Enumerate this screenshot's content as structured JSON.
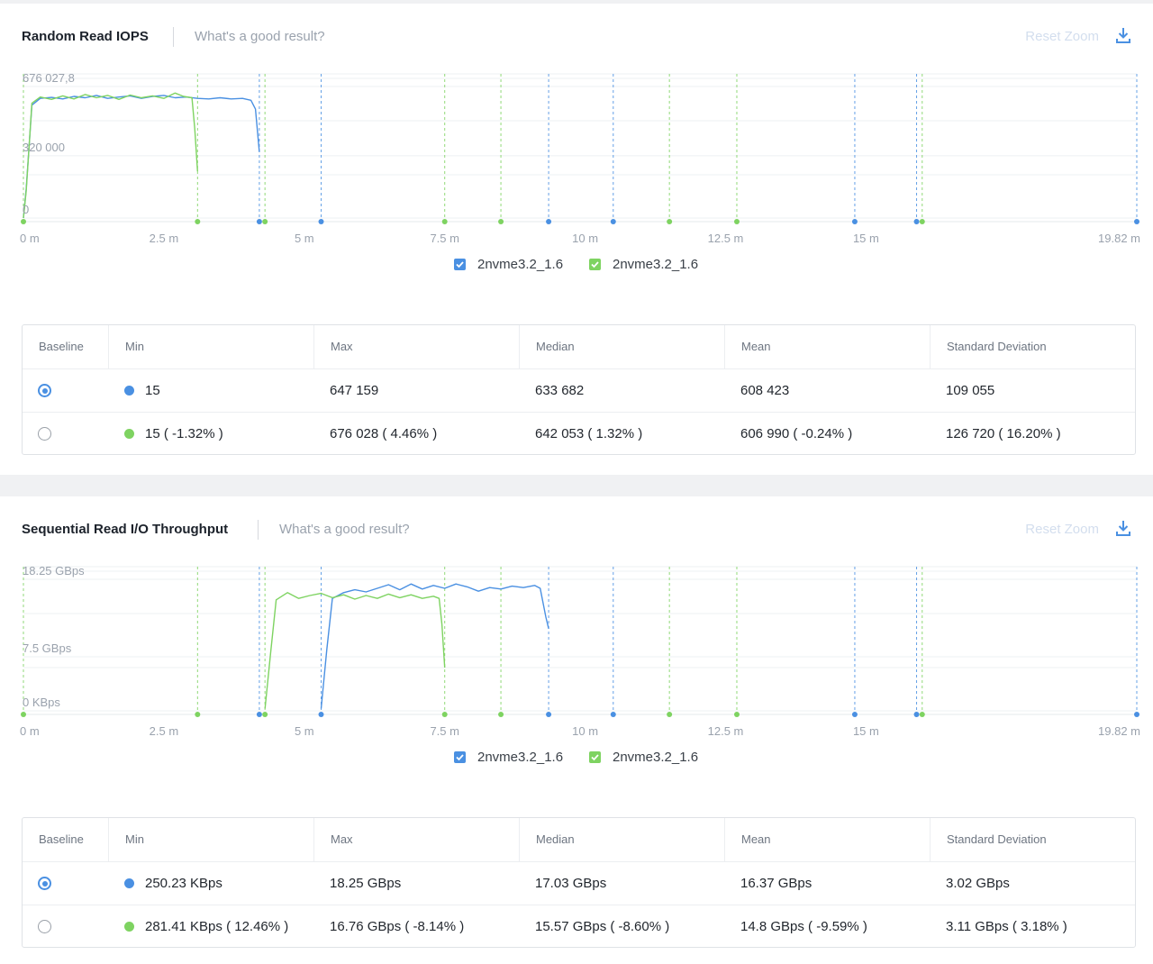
{
  "panels": [
    {
      "title": "Random Read IOPS",
      "link": "What's a good result?",
      "reset_zoom": "Reset Zoom",
      "legend": [
        "2nvme3.2_1.6",
        "2nvme3.2_1.6"
      ],
      "columns": [
        "Baseline",
        "Min",
        "Max",
        "Median",
        "Mean",
        "Standard Deviation"
      ],
      "rows": [
        {
          "baseline": true,
          "color": "#4a90e2",
          "min": "15",
          "max": "647 159",
          "median": "633 682",
          "mean": "608 423",
          "std": "109 055"
        },
        {
          "baseline": false,
          "color": "#7ed361",
          "min": "15 ( -1.32% )",
          "max": "676 028 ( 4.46% )",
          "median": "642 053 ( 1.32% )",
          "mean": "606 990 ( -0.24% )",
          "std": "126 720 ( 16.20% )"
        }
      ]
    },
    {
      "title": "Sequential Read I/O Throughput",
      "link": "What's a good result?",
      "reset_zoom": "Reset Zoom",
      "legend": [
        "2nvme3.2_1.6",
        "2nvme3.2_1.6"
      ],
      "columns": [
        "Baseline",
        "Min",
        "Max",
        "Median",
        "Mean",
        "Standard Deviation"
      ],
      "rows": [
        {
          "baseline": true,
          "color": "#4a90e2",
          "min": "250.23 KBps",
          "max": "18.25 GBps",
          "median": "17.03 GBps",
          "mean": "16.37 GBps",
          "std": "3.02 GBps"
        },
        {
          "baseline": false,
          "color": "#7ed361",
          "min": "281.41 KBps ( 12.46% )",
          "max": "16.76 GBps ( -8.14% )",
          "median": "15.57 GBps ( -8.60% )",
          "mean": "14.8 GBps ( -9.59% )",
          "std": "3.11 GBps ( 3.18% )"
        }
      ]
    }
  ],
  "colors": {
    "blue": "#4a90e2",
    "green": "#7ed361"
  },
  "chart_data": [
    {
      "type": "line",
      "title": "Random Read IOPS",
      "x_unit": "minutes",
      "xlim": [
        0,
        19.82
      ],
      "ylim": [
        0,
        676027.8
      ],
      "x_tick_labels": [
        "0 m",
        "2.5 m",
        "5 m",
        "7.5 m",
        "10 m",
        "12.5 m",
        "15 m",
        "19.82 m"
      ],
      "x_ticks": [
        0,
        2.5,
        5,
        7.5,
        10,
        12.5,
        15,
        19.82
      ],
      "y_tick_labels": [
        "676 027,8",
        "320 000",
        "0"
      ],
      "y_ticks": [
        676027.8,
        320000,
        0
      ],
      "grid": true,
      "legend_position": "bottom-center",
      "event_markers": {
        "blue": [
          4.2,
          5.3,
          9.35,
          10.5,
          14.8,
          15.9,
          19.82
        ],
        "green": [
          0,
          3.1,
          4.3,
          7.5,
          8.5,
          11.5,
          12.7,
          16.0
        ]
      },
      "series": [
        {
          "name": "2nvme3.2_1.6",
          "color": "#4a90e2",
          "x": [
            0,
            0.05,
            0.15,
            0.3,
            0.5,
            0.7,
            0.9,
            1.1,
            1.3,
            1.5,
            1.7,
            1.9,
            2.1,
            2.3,
            2.5,
            2.7,
            2.9,
            3.1,
            3.3,
            3.5,
            3.7,
            3.9,
            4.05,
            4.13,
            4.2
          ],
          "y": [
            0,
            150000,
            580000,
            615000,
            620000,
            612000,
            625000,
            618000,
            630000,
            615000,
            622000,
            628000,
            615000,
            625000,
            630000,
            618000,
            622000,
            615000,
            612000,
            618000,
            612000,
            615000,
            605000,
            560000,
            340000
          ]
        },
        {
          "name": "2nvme3.2_1.6",
          "color": "#7ed361",
          "x": [
            0,
            0.05,
            0.15,
            0.3,
            0.5,
            0.7,
            0.9,
            1.1,
            1.3,
            1.5,
            1.7,
            1.9,
            2.1,
            2.3,
            2.5,
            2.7,
            2.85,
            3.0,
            3.05,
            3.1
          ],
          "y": [
            0,
            140000,
            590000,
            622000,
            610000,
            628000,
            612000,
            635000,
            618000,
            630000,
            610000,
            632000,
            618000,
            628000,
            615000,
            642000,
            625000,
            618000,
            460000,
            240000
          ]
        }
      ]
    },
    {
      "type": "line",
      "title": "Sequential Read I/O Throughput",
      "x_unit": "minutes",
      "xlim": [
        0,
        19.82
      ],
      "ylim": [
        0,
        18.25
      ],
      "x_tick_labels": [
        "0 m",
        "2.5 m",
        "5 m",
        "7.5 m",
        "10 m",
        "12.5 m",
        "15 m",
        "19.82 m"
      ],
      "x_ticks": [
        0,
        2.5,
        5,
        7.5,
        10,
        12.5,
        15,
        19.82
      ],
      "y_tick_labels": [
        "18.25 GBps",
        "7.5 GBps",
        "0 KBps"
      ],
      "y_ticks": [
        18.25,
        7.5,
        0
      ],
      "grid": true,
      "legend_position": "bottom-center",
      "event_markers": {
        "blue": [
          4.2,
          5.3,
          9.35,
          10.5,
          14.8,
          15.9,
          19.82
        ],
        "green": [
          0,
          3.1,
          4.3,
          7.5,
          8.5,
          11.5,
          12.7,
          16.0
        ]
      },
      "series": [
        {
          "name": "2nvme3.2_1.6",
          "color": "#4a90e2",
          "x": [
            5.3,
            5.4,
            5.5,
            5.7,
            5.9,
            6.1,
            6.3,
            6.5,
            6.7,
            6.9,
            7.1,
            7.3,
            7.5,
            7.7,
            7.9,
            8.1,
            8.3,
            8.5,
            8.7,
            8.9,
            9.1,
            9.2,
            9.3,
            9.35
          ],
          "y": [
            0.3,
            8.5,
            15.6,
            16.4,
            16.8,
            16.5,
            17.0,
            17.5,
            16.8,
            17.6,
            16.9,
            17.4,
            17.0,
            17.6,
            17.2,
            16.6,
            17.1,
            16.9,
            17.3,
            17.1,
            17.4,
            17.0,
            13.0,
            11.4
          ]
        },
        {
          "name": "2nvme3.2_1.6",
          "color": "#7ed361",
          "x": [
            4.3,
            4.4,
            4.5,
            4.7,
            4.9,
            5.1,
            5.3,
            5.5,
            5.7,
            5.9,
            6.1,
            6.3,
            6.5,
            6.7,
            6.9,
            7.1,
            7.3,
            7.4,
            7.45,
            7.5
          ],
          "y": [
            0.3,
            8.0,
            15.4,
            16.4,
            15.6,
            16.0,
            16.3,
            15.7,
            16.1,
            15.5,
            16.0,
            15.6,
            16.2,
            15.7,
            16.1,
            15.6,
            15.9,
            15.6,
            12.0,
            6.0
          ]
        }
      ]
    }
  ]
}
